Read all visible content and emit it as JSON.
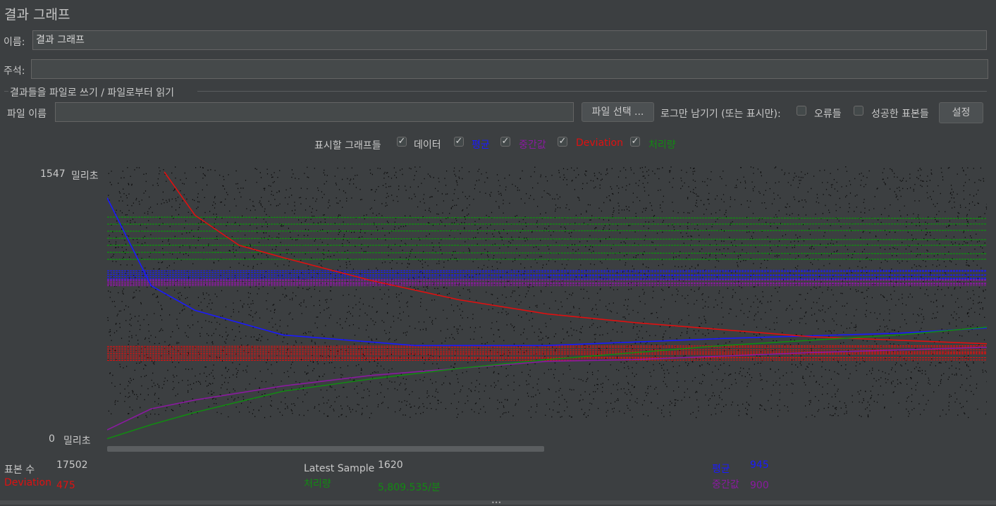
{
  "panel": {
    "title": "결과 그래프"
  },
  "name_field": {
    "label": "이름:",
    "value": "결과 그래프"
  },
  "comment_field": {
    "label": "주석:",
    "value": ""
  },
  "file_section": {
    "header": "결과들을 파일로 쓰기 / 파일로부터 읽기",
    "file_label": "파일 이름",
    "file_value": "",
    "browse_label": "파일 선택 ...",
    "log_only_label": "로그만 남기기 (또는 표시만):",
    "errors_label": "오류들",
    "errors_checked": false,
    "successes_label": "성공한 표본들",
    "successes_checked": false,
    "configure_label": "설정"
  },
  "graphs_toggle": {
    "label": "표시할 그래프들",
    "items": [
      {
        "label": "데이터",
        "checked": true,
        "color": "#c9c9c9"
      },
      {
        "label": "평균",
        "checked": true,
        "color": "#1a1aff"
      },
      {
        "label": "중간값",
        "checked": true,
        "color": "#8a1aa0"
      },
      {
        "label": "Deviation",
        "checked": true,
        "color": "#e01010"
      },
      {
        "label": "처리량",
        "checked": true,
        "color": "#128a12"
      }
    ],
    "check_glyph": "✓"
  },
  "axis": {
    "top_value": "1547",
    "top_unit": "밀리초",
    "bottom_value": "0",
    "bottom_unit": "밀리초"
  },
  "stats": {
    "samples_label": "표본 수",
    "samples_value": "17502",
    "deviation_label": "Deviation",
    "deviation_value": "475",
    "latest_label": "Latest Sample",
    "latest_value": "1620",
    "throughput_label": "처리량",
    "throughput_value": "5,809.535/분",
    "average_label": "평균",
    "average_value": "945",
    "median_label": "중간값",
    "median_value": "900"
  },
  "colors": {
    "data": "#0a0a0a",
    "average": "#1a1aff",
    "median": "#8a1aa0",
    "deviation": "#e01010",
    "throughput": "#128a12",
    "plot_bg": "#3c3f41"
  },
  "chart_data": {
    "type": "line",
    "ylim": [
      0,
      1547
    ],
    "y_unit": "밀리초",
    "series": [
      {
        "name": "평균",
        "points": [
          [
            0,
            1400
          ],
          [
            0.05,
            900
          ],
          [
            0.1,
            760
          ],
          [
            0.2,
            620
          ],
          [
            0.35,
            560
          ],
          [
            0.5,
            560
          ],
          [
            0.6,
            580
          ],
          [
            0.7,
            600
          ],
          [
            0.8,
            615
          ],
          [
            0.9,
            630
          ],
          [
            1,
            660
          ]
        ]
      },
      {
        "name": "중간값",
        "points": [
          [
            0,
            80
          ],
          [
            0.05,
            200
          ],
          [
            0.1,
            250
          ],
          [
            0.2,
            330
          ],
          [
            0.3,
            390
          ],
          [
            0.4,
            430
          ],
          [
            0.5,
            470
          ],
          [
            0.6,
            480
          ],
          [
            0.8,
            520
          ],
          [
            1,
            550
          ]
        ]
      },
      {
        "name": "Deviation",
        "points": [
          [
            0.065,
            1547
          ],
          [
            0.1,
            1300
          ],
          [
            0.15,
            1130
          ],
          [
            0.2,
            1060
          ],
          [
            0.3,
            930
          ],
          [
            0.4,
            820
          ],
          [
            0.5,
            740
          ],
          [
            0.6,
            690
          ],
          [
            0.7,
            650
          ],
          [
            0.8,
            610
          ],
          [
            0.9,
            590
          ],
          [
            1,
            570
          ]
        ]
      },
      {
        "name": "처리량",
        "points": [
          [
            0,
            30
          ],
          [
            0.05,
            110
          ],
          [
            0.1,
            180
          ],
          [
            0.2,
            300
          ],
          [
            0.3,
            370
          ],
          [
            0.4,
            430
          ],
          [
            0.5,
            480
          ],
          [
            0.6,
            520
          ],
          [
            0.7,
            560
          ],
          [
            0.8,
            590
          ],
          [
            0.9,
            620
          ],
          [
            1,
            665
          ]
        ]
      }
    ],
    "bands": [
      {
        "series": "평균",
        "from": 930,
        "to": 985
      },
      {
        "series": "중간값",
        "from": 900,
        "to": 935
      },
      {
        "series": "Deviation",
        "from": 475,
        "to": 555
      },
      {
        "series": "처리량",
        "from": 1050,
        "to": 1290
      }
    ]
  }
}
